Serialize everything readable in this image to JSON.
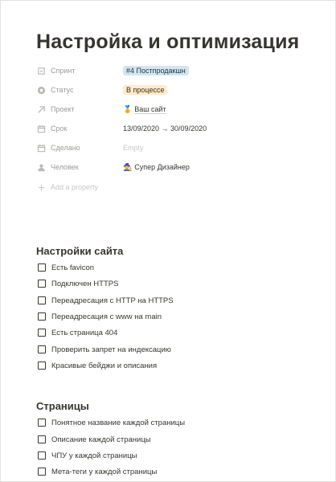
{
  "page": {
    "title": "Настройка и оптимизация"
  },
  "properties": [
    {
      "name": "Спринт",
      "icon": "relation-icon",
      "value": "#4 Постпродакшн",
      "type": "tag",
      "color": "#d3e5ef"
    },
    {
      "name": "Статус",
      "icon": "status-icon",
      "value": "В процессе",
      "type": "tag",
      "color": "#fdecc8"
    },
    {
      "name": "Проект",
      "icon": "arrow-up-right-icon",
      "value": "Ваш сайт",
      "type": "link",
      "emoji": "🏅"
    },
    {
      "name": "Срок",
      "icon": "calendar-icon",
      "value": "13/09/2020 → 30/09/2020",
      "type": "text"
    },
    {
      "name": "Сделано",
      "icon": "calendar-icon",
      "value": "Empty",
      "type": "empty"
    },
    {
      "name": "Человек",
      "icon": "person-icon",
      "value": "Супер Дизайнер",
      "type": "person",
      "emoji": "🧙"
    }
  ],
  "add_property": {
    "label": "Add a property",
    "icon": "plus-icon"
  },
  "sections": [
    {
      "title": "Настройки сайта",
      "items": [
        "Есть favicon",
        "Подключен HTTPS",
        "Переадресация с HTTP на HTTPS",
        "Переадресация с www на main",
        "Есть страница 404",
        "Проверить запрет на индексацию",
        "Красивые бейджи и описания"
      ]
    },
    {
      "title": "Страницы",
      "items": [
        "Понятное название каждой страницы",
        "Описание каждой страницы",
        "ЧПУ у каждой страницы",
        "Мета-теги у каждой страницы"
      ]
    }
  ]
}
